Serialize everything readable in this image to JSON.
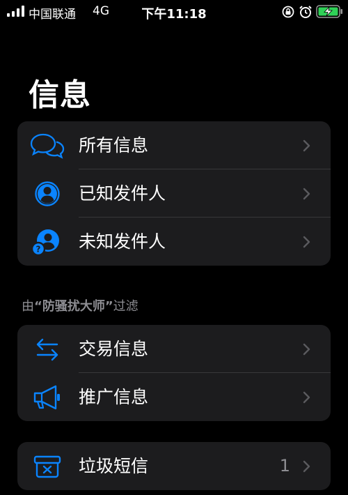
{
  "status_bar": {
    "carrier": "中国联通",
    "network": "4G",
    "time": "下午11:18",
    "icons": [
      "signal-icon",
      "orientation-lock-icon",
      "alarm-icon",
      "battery-charging-icon"
    ]
  },
  "page": {
    "title": "信息"
  },
  "accent_color": "#0a84ff",
  "groups": {
    "senders": [
      {
        "label": "所有信息",
        "icon": "chat-bubbles-icon"
      },
      {
        "label": "已知发件人",
        "icon": "person-circle-icon"
      },
      {
        "label": "未知发件人",
        "icon": "unknown-person-icon"
      }
    ],
    "filter_caption": {
      "prefix": "由",
      "name": "“防骚扰大师”",
      "suffix": "过滤"
    },
    "filtered": [
      {
        "label": "交易信息",
        "icon": "arrows-left-right-icon"
      },
      {
        "label": "推广信息",
        "icon": "megaphone-icon"
      }
    ],
    "junk": [
      {
        "label": "垃圾短信",
        "icon": "junk-tray-icon",
        "count": "1"
      }
    ]
  }
}
